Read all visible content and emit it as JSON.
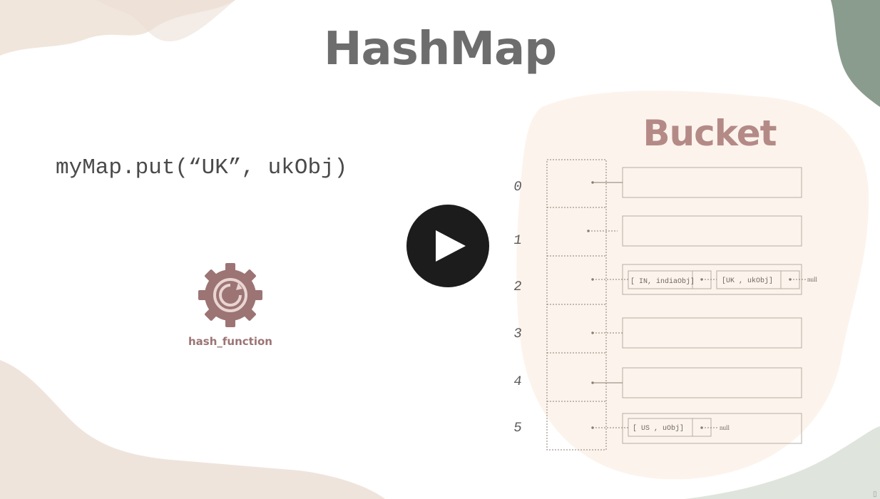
{
  "slide": {
    "title": "HashMap",
    "code_line": "myMap.put(“UK”, ukObj)",
    "gear_label": "hash_function",
    "bucket_title": "Bucket"
  },
  "bucket": {
    "indices": [
      "0",
      "1",
      "2",
      "3",
      "4",
      "5"
    ],
    "entries": {
      "row2_node1": "[ IN, indiaObj]",
      "row2_node2": "[UK , ukObj]",
      "row2_null": "null",
      "row5_node1": "[ US , uObj]",
      "row5_null": "null"
    }
  },
  "player": {
    "play_icon": "play-icon",
    "corner_icon": "trash-icon",
    "corner_glyph": "▯"
  },
  "colors": {
    "title": "#6d6d6d",
    "accent": "#b48a87",
    "gear": "#9c7474",
    "play_bg": "#1c1c1c"
  }
}
